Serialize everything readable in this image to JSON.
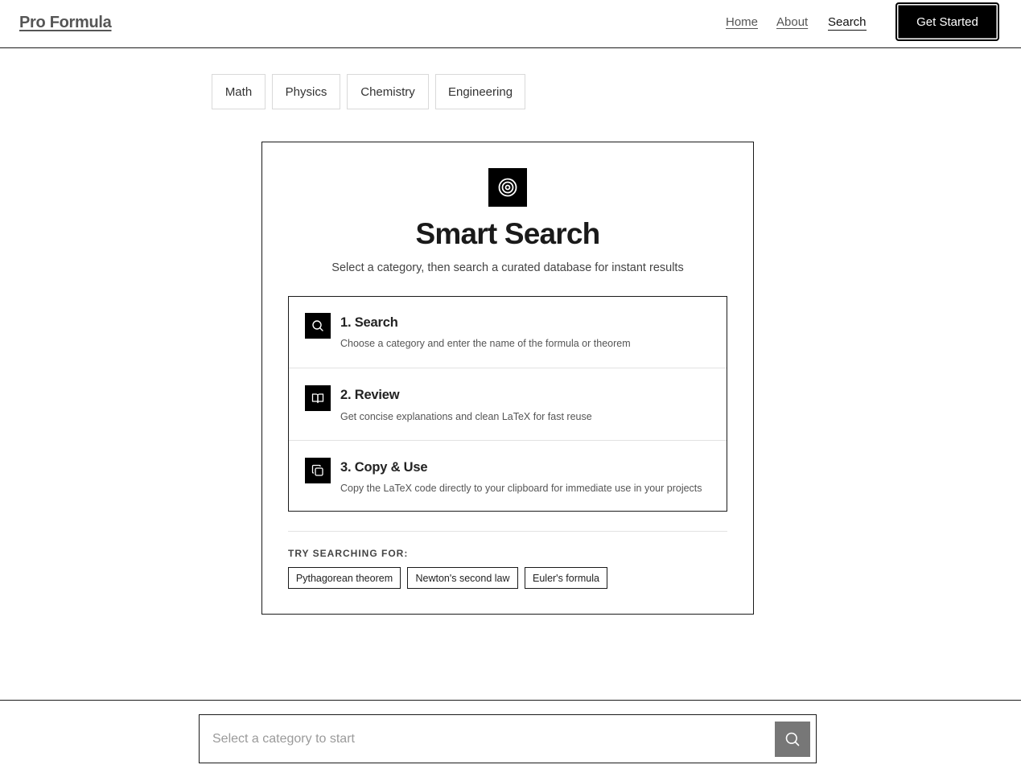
{
  "header": {
    "brand": "Pro Formula",
    "nav": [
      {
        "label": "Home"
      },
      {
        "label": "About"
      },
      {
        "label": "Search"
      }
    ],
    "cta_label": "Get Started"
  },
  "categories": [
    "Math",
    "Physics",
    "Chemistry",
    "Engineering"
  ],
  "card": {
    "icon": "target-icon",
    "title": "Smart Search",
    "subtitle": "Select a category, then search a curated database for instant results",
    "steps": [
      {
        "title": "1. Search",
        "description": "Choose a category and enter the name of the formula or theorem",
        "icon": "search-icon"
      },
      {
        "title": "2. Review",
        "description": "Get concise explanations and clean LaTeX for fast reuse",
        "icon": "book-open-icon"
      },
      {
        "title": "3. Copy & Use",
        "description": "Copy the LaTeX code directly to your clipboard for immediate use in your projects",
        "icon": "copy-icon"
      }
    ],
    "try_label": "TRY SEARCHING FOR:",
    "suggestions": [
      "Pythagorean theorem",
      "Newton's second law",
      "Euler's formula"
    ]
  },
  "search": {
    "placeholder": "Select a category to start",
    "button_icon": "search-icon"
  },
  "colors": {
    "accent": "#000000",
    "border": "#1a1a1a",
    "search_button": "#777777"
  }
}
